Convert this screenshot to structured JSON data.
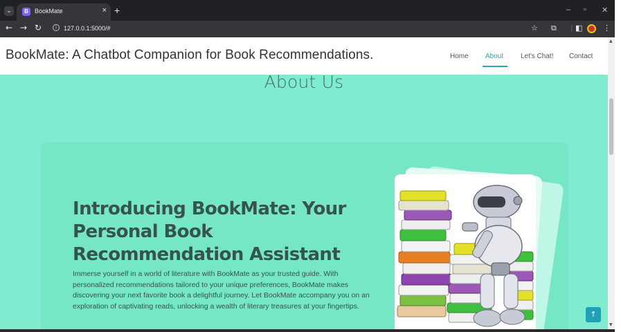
{
  "browser": {
    "tab_favicon_letter": "B",
    "tab_title": "BookMate",
    "tab_close": "×",
    "new_tab": "+",
    "url": "127.0.0.1:5000/#",
    "icons": [
      "tab-search-icon",
      "back-icon",
      "forward-icon",
      "reload-icon",
      "site-info-icon",
      "bookmark-star-icon",
      "extensions-icon",
      "side-panel-icon",
      "profile-avatar-icon",
      "kebab-menu-icon",
      "minimize-icon",
      "maximize-icon",
      "close-icon"
    ]
  },
  "site": {
    "brand": "BookMate: A Chatbot Companion for Book Recommendations.",
    "nav": [
      "Home",
      "About",
      "Let's Chat!",
      "Contact"
    ],
    "active_nav": "About",
    "accent_color": "#2aa2b5",
    "background_color": "#7fecd0"
  },
  "about": {
    "section_title": "About Us",
    "heading": "Introducing BookMate: Your Personal Book Recommendation Assistant",
    "body": "Immerse yourself in a world of literature with BookMate as your trusted guide. With personalized recommendations tailored to your unique preferences, BookMate makes discovering your next favorite book a delightful journey. Let BookMate accompany you on an exploration of captivating reads, unlocking a wealth of literary treasures at your fingertips."
  },
  "back_to_top": "↑"
}
